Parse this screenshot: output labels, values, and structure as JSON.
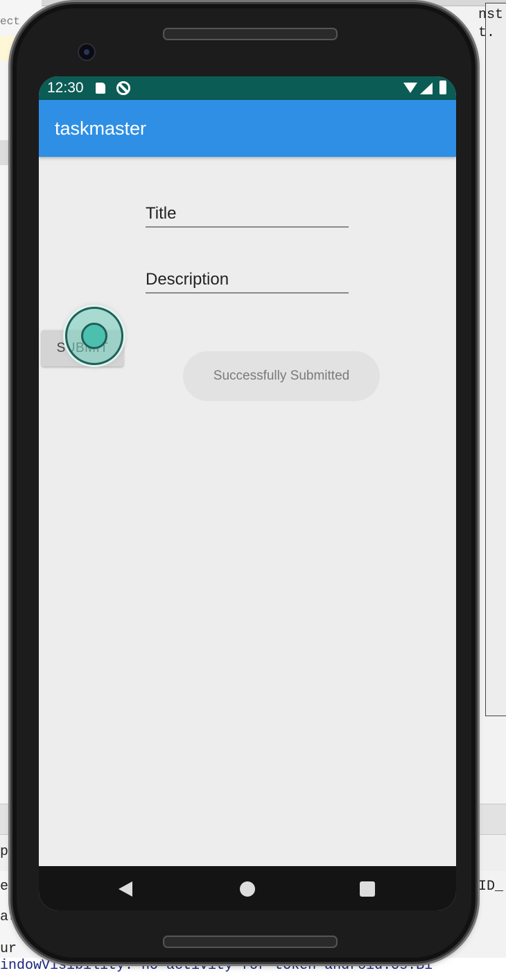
{
  "ide": {
    "left_text": [
      "ect",
      "p",
      "e",
      "at",
      "ur"
    ],
    "right_code": [
      "nst",
      "t.",
      "ID_"
    ],
    "log_line": "indowVisibility: no activity for token android.os.Bi"
  },
  "status_bar": {
    "time": "12:30",
    "icons": [
      "sd-card-icon",
      "sync-icon",
      "wifi-icon",
      "signal-icon",
      "battery-icon"
    ]
  },
  "app_bar": {
    "title": "taskmaster"
  },
  "form": {
    "title_hint": "Title",
    "description_hint": "Description",
    "submit_label": "SUBMIT"
  },
  "toast": {
    "message": "Successfully Submitted"
  },
  "nav_bar": {
    "icons": [
      "back-icon",
      "home-icon",
      "recents-icon"
    ]
  },
  "colors": {
    "status_bar": "#0b5c55",
    "app_bar": "#2e8fe5",
    "touch_indicator": "#4dbfae"
  }
}
